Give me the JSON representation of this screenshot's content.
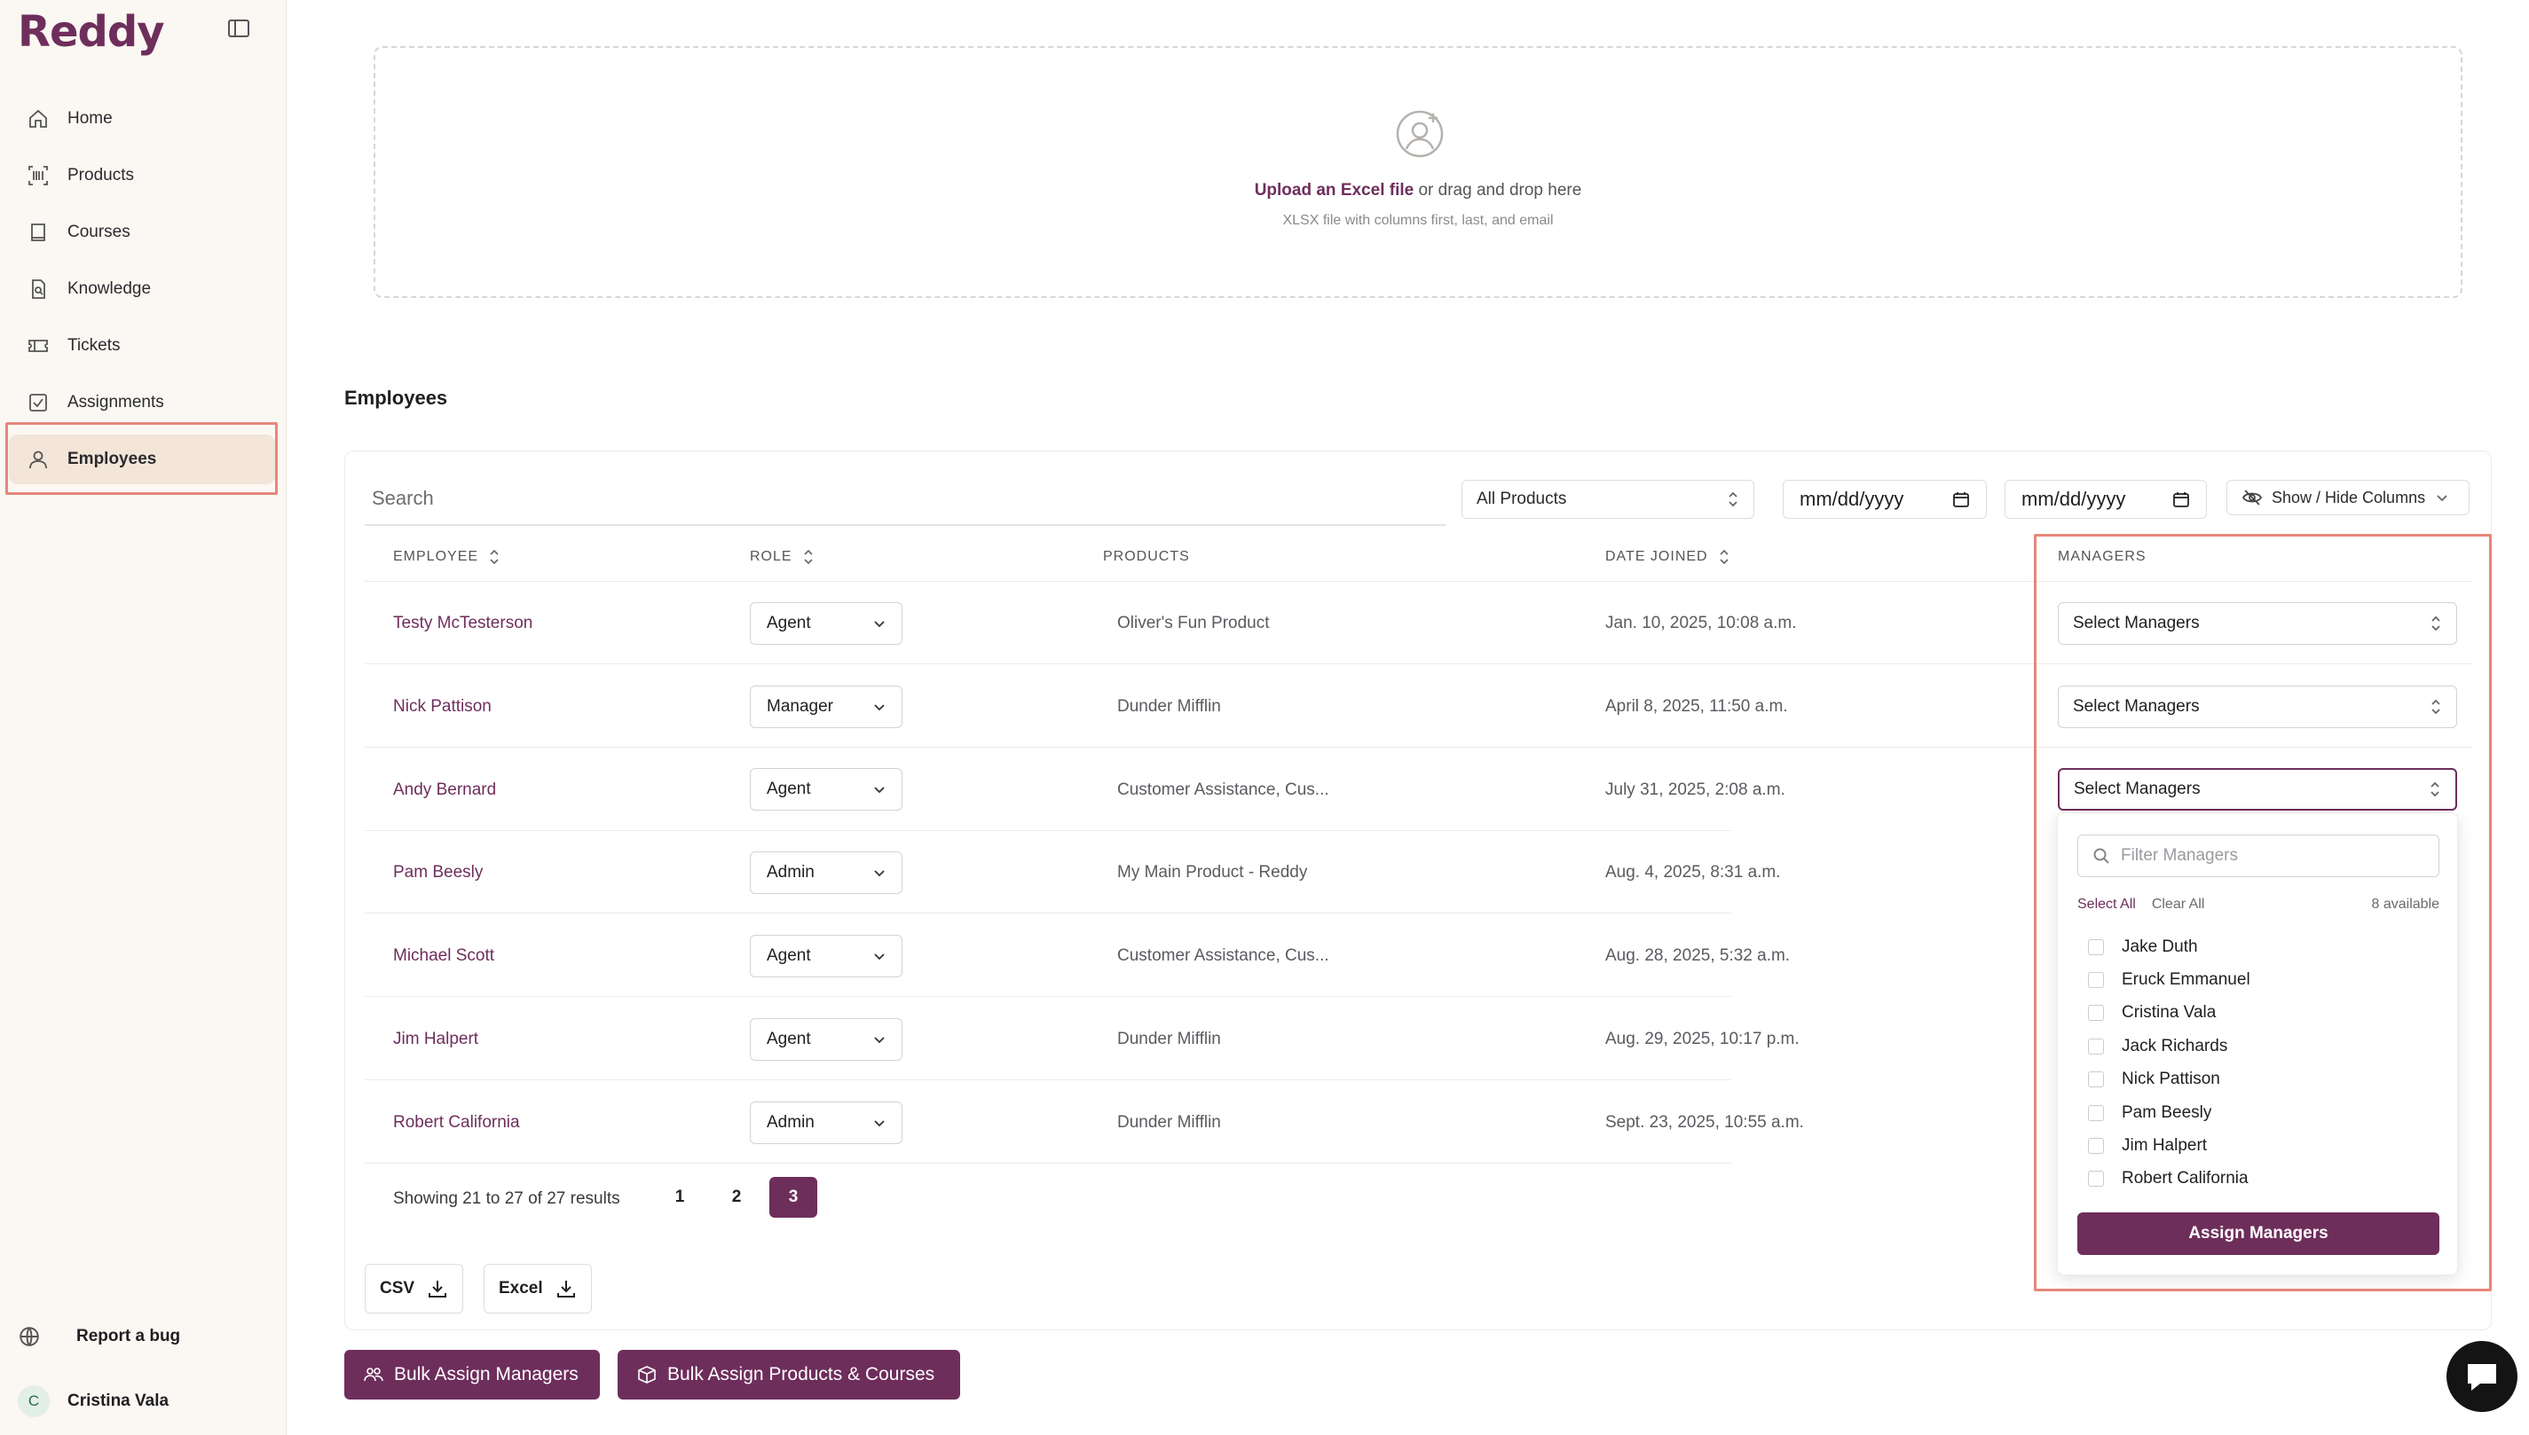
{
  "app": {
    "name": "Reddy"
  },
  "sidebar": {
    "items": [
      {
        "label": "Home",
        "icon": "home-icon"
      },
      {
        "label": "Products",
        "icon": "barcode-icon"
      },
      {
        "label": "Courses",
        "icon": "book-icon"
      },
      {
        "label": "Knowledge",
        "icon": "document-icon"
      },
      {
        "label": "Tickets",
        "icon": "ticket-icon"
      },
      {
        "label": "Assignments",
        "icon": "checkbox-icon"
      },
      {
        "label": "Employees",
        "icon": "user-icon",
        "active": true
      }
    ],
    "report_bug": "Report a bug",
    "user": {
      "initial": "C",
      "name": "Cristina Vala"
    }
  },
  "upload": {
    "link_text": "Upload an Excel file",
    "rest_text": " or drag and drop here",
    "hint": "XLSX file with columns first, last, and email"
  },
  "section_title": "Employees",
  "filters": {
    "search_placeholder": "Search",
    "products_select": "All Products",
    "date_from_placeholder": "mm/dd/yyyy",
    "date_to_placeholder": "mm/dd/yyyy",
    "columns_toggle": "Show / Hide Columns"
  },
  "table": {
    "headers": {
      "employee": "EMPLOYEE",
      "role": "ROLE",
      "products": "PRODUCTS",
      "date_joined": "DATE JOINED",
      "managers": "MANAGERS"
    },
    "manager_placeholder": "Select Managers",
    "rows": [
      {
        "name": "Testy McTesterson",
        "role": "Agent",
        "products": "Oliver's Fun Product",
        "date": "Jan. 10, 2025, 10:08 a.m."
      },
      {
        "name": "Nick Pattison",
        "role": "Manager",
        "products": "Dunder Mifflin",
        "date": "April 8, 2025, 11:50 a.m."
      },
      {
        "name": "Andy Bernard",
        "role": "Agent",
        "products": "Customer Assistance, Cus...",
        "date": "July 31, 2025, 2:08 a.m."
      },
      {
        "name": "Pam Beesly",
        "role": "Admin",
        "products": "My Main Product - Reddy",
        "date": "Aug. 4, 2025, 8:31 a.m."
      },
      {
        "name": "Michael Scott",
        "role": "Agent",
        "products": "Customer Assistance, Cus...",
        "date": "Aug. 28, 2025, 5:32 a.m."
      },
      {
        "name": "Jim Halpert",
        "role": "Agent",
        "products": "Dunder Mifflin",
        "date": "Aug. 29, 2025, 10:17 p.m."
      },
      {
        "name": "Robert California",
        "role": "Admin",
        "products": "Dunder Mifflin",
        "date": "Sept. 23, 2025, 10:55 a.m."
      }
    ]
  },
  "pagination": {
    "summary": "Showing 21 to 27 of 27 results",
    "pages": [
      "1",
      "2",
      "3"
    ],
    "current": "3"
  },
  "export": {
    "csv": "CSV",
    "excel": "Excel"
  },
  "manager_dropdown": {
    "filter_placeholder": "Filter Managers",
    "select_all": "Select All",
    "clear_all": "Clear All",
    "available": "8 available",
    "options": [
      "Jake Duth",
      "Eruck Emmanuel",
      "Cristina Vala",
      "Jack Richards",
      "Nick Pattison",
      "Pam Beesly",
      "Jim Halpert",
      "Robert California"
    ],
    "assign_label": "Assign Managers"
  },
  "bulk": {
    "assign_managers": "Bulk Assign Managers",
    "assign_products": "Bulk Assign Products & Courses"
  },
  "colors": {
    "brand": "#6e2e5c",
    "highlight": "#e6877a",
    "sidebar_bg": "#fbf7f2"
  }
}
